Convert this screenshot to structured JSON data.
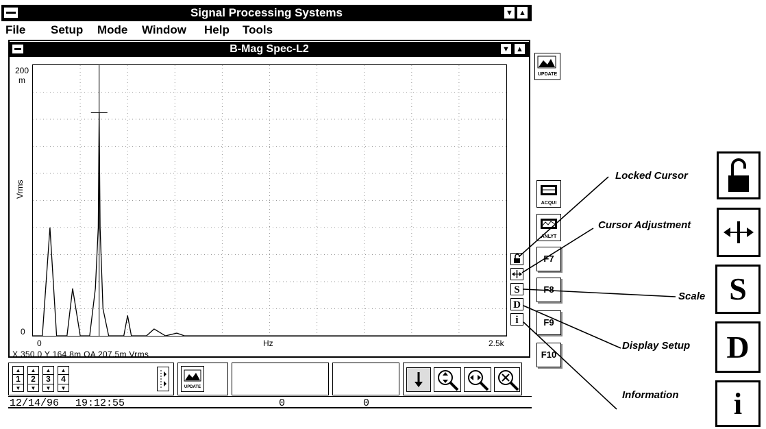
{
  "app": {
    "title": "Signal Processing Systems"
  },
  "menu": [
    "File",
    "Setup",
    "Mode",
    "Window",
    "Help",
    "Tools"
  ],
  "child_window": {
    "title": "B-Mag Spec-L2"
  },
  "plot": {
    "y_top_label": "200",
    "y_unit_label": "m",
    "y_axis_label": "Vrms",
    "y_bottom_label": "0",
    "x_left_label": "0",
    "x_center_label": "Hz",
    "x_right_label": "2.5k",
    "readout": "X 350.0  Y 164.8m  OA 207.5m  Vrms"
  },
  "chart_data": {
    "type": "line",
    "title": "B-Mag Spec-L2",
    "xlabel": "Hz",
    "ylabel": "Vrms",
    "xlim": [
      0,
      2500
    ],
    "ylim": [
      0,
      200
    ],
    "grid": true,
    "series": [
      {
        "x": [
          0,
          50,
          90,
          125,
          150,
          180,
          210,
          250,
          300,
          330,
          345,
          350,
          355,
          370,
          400,
          450,
          480,
          500,
          520,
          600,
          640,
          700,
          760,
          800,
          2500
        ],
        "values": [
          0,
          0,
          80,
          0,
          0,
          0,
          35,
          0,
          0,
          35,
          80,
          165,
          80,
          20,
          0,
          0,
          0,
          15,
          0,
          0,
          5,
          0,
          2,
          0,
          0
        ]
      }
    ],
    "cursor_x": 350,
    "cursor_y": 164.8
  },
  "sidebar_tools": {
    "update": "UPDATE",
    "acqui": "ACQUI",
    "anlyt": "ANLYT",
    "f7": "F7",
    "f8": "F8",
    "f9": "F9",
    "f10": "F10",
    "scale_glyph": "S",
    "display_glyph": "D",
    "info_glyph": "i"
  },
  "callouts": {
    "locked_cursor": "Locked Cursor",
    "cursor_adjustment": "Cursor Adjustment",
    "scale": "Scale",
    "display_setup": "Display Setup",
    "information": "Information",
    "scale_glyph": "S",
    "display_glyph": "D",
    "info_glyph": "i"
  },
  "bottom": {
    "channels": [
      "1",
      "2",
      "3",
      "4"
    ],
    "update": "UPDATE",
    "date": "12/14/96",
    "time": "19:12:55",
    "value1": "0",
    "value2": "0"
  }
}
